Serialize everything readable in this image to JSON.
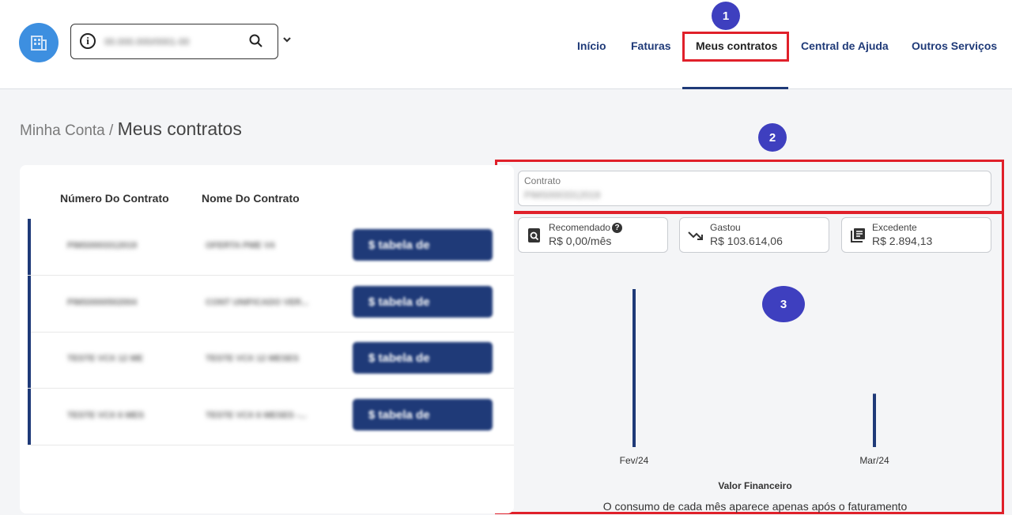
{
  "header": {
    "search_value": "00.000.000/0001-00",
    "nav": [
      "Início",
      "Faturas",
      "Meus contratos",
      "Central de Ajuda",
      "Outros Serviços"
    ]
  },
  "annotations": [
    "1",
    "2",
    "3"
  ],
  "breadcrumb": {
    "parent": "Minha Conta /",
    "current": "Meus contratos"
  },
  "table": {
    "headers": [
      "Número Do Contrato",
      "Nome Do Contrato"
    ],
    "rows": [
      {
        "number": "PIMS0003312019",
        "name": "OFERTA PME V4",
        "action": "$ tabela de"
      },
      {
        "number": "PIMS0000502004",
        "name": "CONT UNIFICADO VER...",
        "action": "$ tabela de"
      },
      {
        "number": "TESTE VCX 12 ME",
        "name": "TESTE VCX 12 MESES",
        "action": "$ tabela de"
      },
      {
        "number": "TESTE VCX 6 MES",
        "name": "TESTE VCX 6 MESES -...",
        "action": "$ tabela de"
      }
    ]
  },
  "contract_field": {
    "label": "Contrato",
    "value": "PIMS0003312019"
  },
  "metrics": [
    {
      "label": "Recomendado",
      "value": "R$ 0,00/mês",
      "icon": "search-document-icon"
    },
    {
      "label": "Gastou",
      "value": "R$ 103.614,06",
      "icon": "trending-down-icon"
    },
    {
      "label": "Excedente",
      "value": "R$ 2.894,13",
      "icon": "library-books-icon"
    }
  ],
  "chart_data": {
    "type": "bar",
    "categories": [
      "Fev/24",
      "Mar/24"
    ],
    "values": [
      103614.06,
      35000
    ],
    "xlabel": "Valor Financeiro",
    "bar_color": "#1f3a78"
  },
  "footnote": "O consumo de cada mês aparece apenas após o faturamento",
  "colors": {
    "primary": "#1f3a78",
    "highlight": "#e0202a",
    "badge": "#3e3fbf",
    "logo": "#3d8fe0"
  }
}
